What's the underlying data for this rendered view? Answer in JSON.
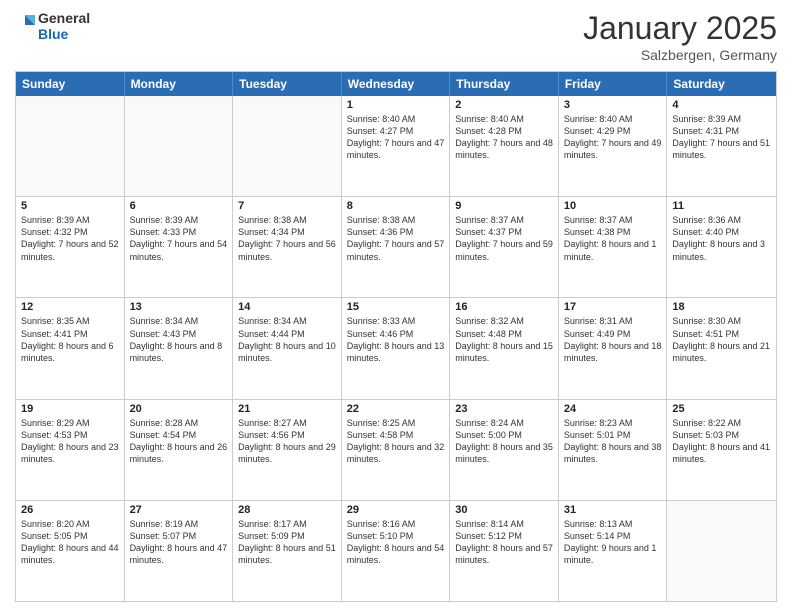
{
  "header": {
    "logo_line1": "General",
    "logo_line2": "Blue",
    "month": "January 2025",
    "location": "Salzbergen, Germany"
  },
  "days": [
    "Sunday",
    "Monday",
    "Tuesday",
    "Wednesday",
    "Thursday",
    "Friday",
    "Saturday"
  ],
  "weeks": [
    [
      {
        "day": "",
        "info": "",
        "empty": true
      },
      {
        "day": "",
        "info": "",
        "empty": true
      },
      {
        "day": "",
        "info": "",
        "empty": true
      },
      {
        "day": "1",
        "info": "Sunrise: 8:40 AM\nSunset: 4:27 PM\nDaylight: 7 hours and 47 minutes.",
        "empty": false
      },
      {
        "day": "2",
        "info": "Sunrise: 8:40 AM\nSunset: 4:28 PM\nDaylight: 7 hours and 48 minutes.",
        "empty": false
      },
      {
        "day": "3",
        "info": "Sunrise: 8:40 AM\nSunset: 4:29 PM\nDaylight: 7 hours and 49 minutes.",
        "empty": false
      },
      {
        "day": "4",
        "info": "Sunrise: 8:39 AM\nSunset: 4:31 PM\nDaylight: 7 hours and 51 minutes.",
        "empty": false
      }
    ],
    [
      {
        "day": "5",
        "info": "Sunrise: 8:39 AM\nSunset: 4:32 PM\nDaylight: 7 hours and 52 minutes.",
        "empty": false
      },
      {
        "day": "6",
        "info": "Sunrise: 8:39 AM\nSunset: 4:33 PM\nDaylight: 7 hours and 54 minutes.",
        "empty": false
      },
      {
        "day": "7",
        "info": "Sunrise: 8:38 AM\nSunset: 4:34 PM\nDaylight: 7 hours and 56 minutes.",
        "empty": false
      },
      {
        "day": "8",
        "info": "Sunrise: 8:38 AM\nSunset: 4:36 PM\nDaylight: 7 hours and 57 minutes.",
        "empty": false
      },
      {
        "day": "9",
        "info": "Sunrise: 8:37 AM\nSunset: 4:37 PM\nDaylight: 7 hours and 59 minutes.",
        "empty": false
      },
      {
        "day": "10",
        "info": "Sunrise: 8:37 AM\nSunset: 4:38 PM\nDaylight: 8 hours and 1 minute.",
        "empty": false
      },
      {
        "day": "11",
        "info": "Sunrise: 8:36 AM\nSunset: 4:40 PM\nDaylight: 8 hours and 3 minutes.",
        "empty": false
      }
    ],
    [
      {
        "day": "12",
        "info": "Sunrise: 8:35 AM\nSunset: 4:41 PM\nDaylight: 8 hours and 6 minutes.",
        "empty": false
      },
      {
        "day": "13",
        "info": "Sunrise: 8:34 AM\nSunset: 4:43 PM\nDaylight: 8 hours and 8 minutes.",
        "empty": false
      },
      {
        "day": "14",
        "info": "Sunrise: 8:34 AM\nSunset: 4:44 PM\nDaylight: 8 hours and 10 minutes.",
        "empty": false
      },
      {
        "day": "15",
        "info": "Sunrise: 8:33 AM\nSunset: 4:46 PM\nDaylight: 8 hours and 13 minutes.",
        "empty": false
      },
      {
        "day": "16",
        "info": "Sunrise: 8:32 AM\nSunset: 4:48 PM\nDaylight: 8 hours and 15 minutes.",
        "empty": false
      },
      {
        "day": "17",
        "info": "Sunrise: 8:31 AM\nSunset: 4:49 PM\nDaylight: 8 hours and 18 minutes.",
        "empty": false
      },
      {
        "day": "18",
        "info": "Sunrise: 8:30 AM\nSunset: 4:51 PM\nDaylight: 8 hours and 21 minutes.",
        "empty": false
      }
    ],
    [
      {
        "day": "19",
        "info": "Sunrise: 8:29 AM\nSunset: 4:53 PM\nDaylight: 8 hours and 23 minutes.",
        "empty": false
      },
      {
        "day": "20",
        "info": "Sunrise: 8:28 AM\nSunset: 4:54 PM\nDaylight: 8 hours and 26 minutes.",
        "empty": false
      },
      {
        "day": "21",
        "info": "Sunrise: 8:27 AM\nSunset: 4:56 PM\nDaylight: 8 hours and 29 minutes.",
        "empty": false
      },
      {
        "day": "22",
        "info": "Sunrise: 8:25 AM\nSunset: 4:58 PM\nDaylight: 8 hours and 32 minutes.",
        "empty": false
      },
      {
        "day": "23",
        "info": "Sunrise: 8:24 AM\nSunset: 5:00 PM\nDaylight: 8 hours and 35 minutes.",
        "empty": false
      },
      {
        "day": "24",
        "info": "Sunrise: 8:23 AM\nSunset: 5:01 PM\nDaylight: 8 hours and 38 minutes.",
        "empty": false
      },
      {
        "day": "25",
        "info": "Sunrise: 8:22 AM\nSunset: 5:03 PM\nDaylight: 8 hours and 41 minutes.",
        "empty": false
      }
    ],
    [
      {
        "day": "26",
        "info": "Sunrise: 8:20 AM\nSunset: 5:05 PM\nDaylight: 8 hours and 44 minutes.",
        "empty": false
      },
      {
        "day": "27",
        "info": "Sunrise: 8:19 AM\nSunset: 5:07 PM\nDaylight: 8 hours and 47 minutes.",
        "empty": false
      },
      {
        "day": "28",
        "info": "Sunrise: 8:17 AM\nSunset: 5:09 PM\nDaylight: 8 hours and 51 minutes.",
        "empty": false
      },
      {
        "day": "29",
        "info": "Sunrise: 8:16 AM\nSunset: 5:10 PM\nDaylight: 8 hours and 54 minutes.",
        "empty": false
      },
      {
        "day": "30",
        "info": "Sunrise: 8:14 AM\nSunset: 5:12 PM\nDaylight: 8 hours and 57 minutes.",
        "empty": false
      },
      {
        "day": "31",
        "info": "Sunrise: 8:13 AM\nSunset: 5:14 PM\nDaylight: 9 hours and 1 minute.",
        "empty": false
      },
      {
        "day": "",
        "info": "",
        "empty": true
      }
    ]
  ]
}
